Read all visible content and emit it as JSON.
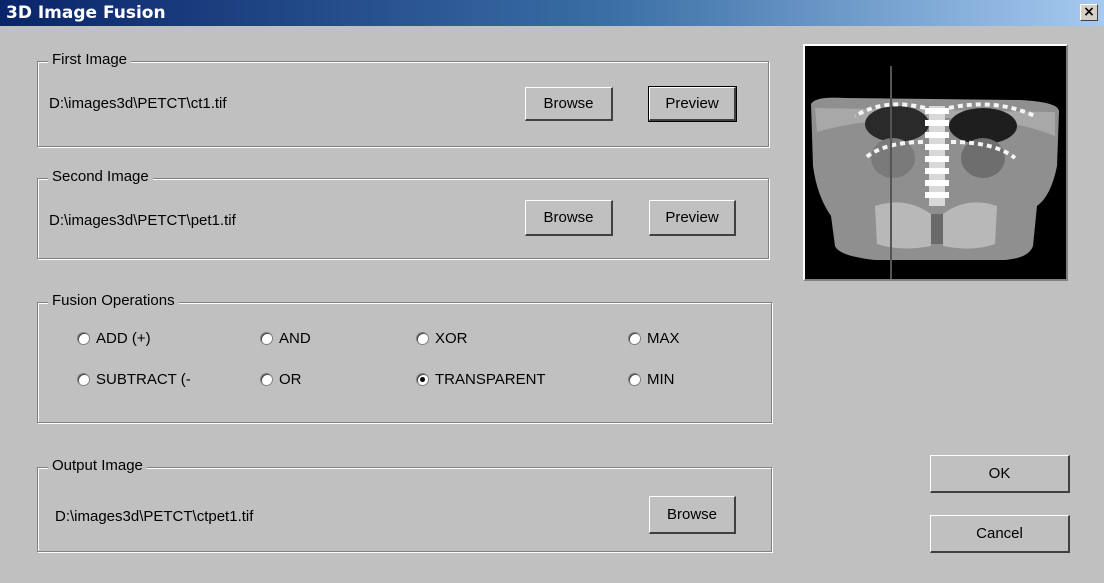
{
  "window": {
    "title": "3D Image Fusion",
    "close_symbol": "×"
  },
  "first_image": {
    "legend": "First Image",
    "path": "D:\\images3d\\PETCT\\ct1.tif",
    "browse_label": "Browse",
    "preview_label": "Preview"
  },
  "second_image": {
    "legend": "Second Image",
    "path": "D:\\images3d\\PETCT\\pet1.tif",
    "browse_label": "Browse",
    "preview_label": "Preview"
  },
  "fusion": {
    "legend": "Fusion Operations",
    "options": [
      "ADD (+)",
      "AND",
      "XOR",
      "MAX",
      "SUBTRACT (-",
      "OR",
      "TRANSPARENT",
      "MIN"
    ],
    "selected": "TRANSPARENT"
  },
  "output_image": {
    "legend": "Output Image",
    "path": "D:\\images3d\\PETCT\\ctpet1.tif",
    "browse_label": "Browse"
  },
  "actions": {
    "ok_label": "OK",
    "cancel_label": "Cancel"
  },
  "preview": {
    "alt": "coronal CT preview image"
  }
}
